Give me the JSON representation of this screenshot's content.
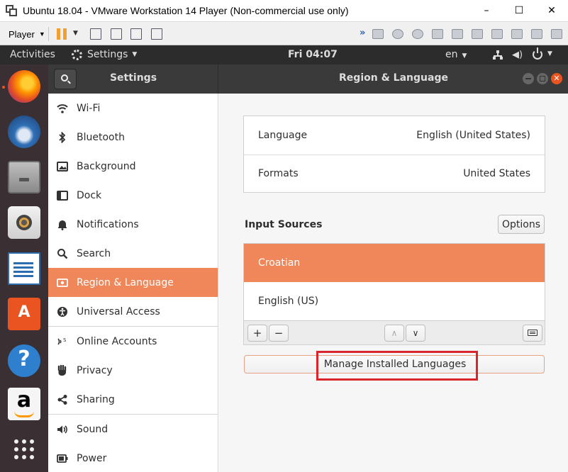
{
  "vm": {
    "title": "Ubuntu 18.04 - VMware Workstation 14 Player (Non-commercial use only)",
    "player_label": "Player",
    "window_buttons": {
      "minimize": "–",
      "maximize": "☐",
      "close": "✕"
    }
  },
  "topbar": {
    "activities": "Activities",
    "app_menu": "Settings",
    "clock": "Fri 04:07",
    "input_lang": "en"
  },
  "dock": {
    "apps": [
      "firefox-icon",
      "thunderbird-icon",
      "files-icon",
      "rhythmbox-icon",
      "libreoffice-writer-icon",
      "ubuntu-software-icon",
      "help-icon",
      "amazon-icon",
      "show-applications-icon"
    ]
  },
  "settings": {
    "sidebar_title": "Settings",
    "panel_title": "Region & Language",
    "sidebar": [
      {
        "label": "Wi-Fi",
        "icon": "wifi-icon"
      },
      {
        "label": "Bluetooth",
        "icon": "bluetooth-icon"
      },
      {
        "label": "Background",
        "icon": "background-icon"
      },
      {
        "label": "Dock",
        "icon": "dock-icon"
      },
      {
        "label": "Notifications",
        "icon": "notifications-icon"
      },
      {
        "label": "Search",
        "icon": "search-icon"
      },
      {
        "label": "Region & Language",
        "icon": "region-icon",
        "active": true
      },
      {
        "label": "Universal Access",
        "icon": "universal-access-icon"
      },
      {
        "label": "Online Accounts",
        "icon": "online-accounts-icon"
      },
      {
        "label": "Privacy",
        "icon": "privacy-icon"
      },
      {
        "label": "Sharing",
        "icon": "sharing-icon"
      },
      {
        "label": "Sound",
        "icon": "sound-icon"
      },
      {
        "label": "Power",
        "icon": "power-icon"
      }
    ],
    "language": {
      "label": "Language",
      "value": "English (United States)"
    },
    "formats": {
      "label": "Formats",
      "value": "United States"
    },
    "input_sources": {
      "label": "Input Sources",
      "options_button": "Options",
      "sources": [
        {
          "label": "Croatian",
          "selected": true
        },
        {
          "label": "English (US)",
          "selected": false
        }
      ],
      "add": "+",
      "remove": "−",
      "up": "∧",
      "down": "∨"
    },
    "manage_button": "Manage Installed Languages",
    "accent_color": "#f0875a",
    "highlight_color": "#d9262c"
  }
}
